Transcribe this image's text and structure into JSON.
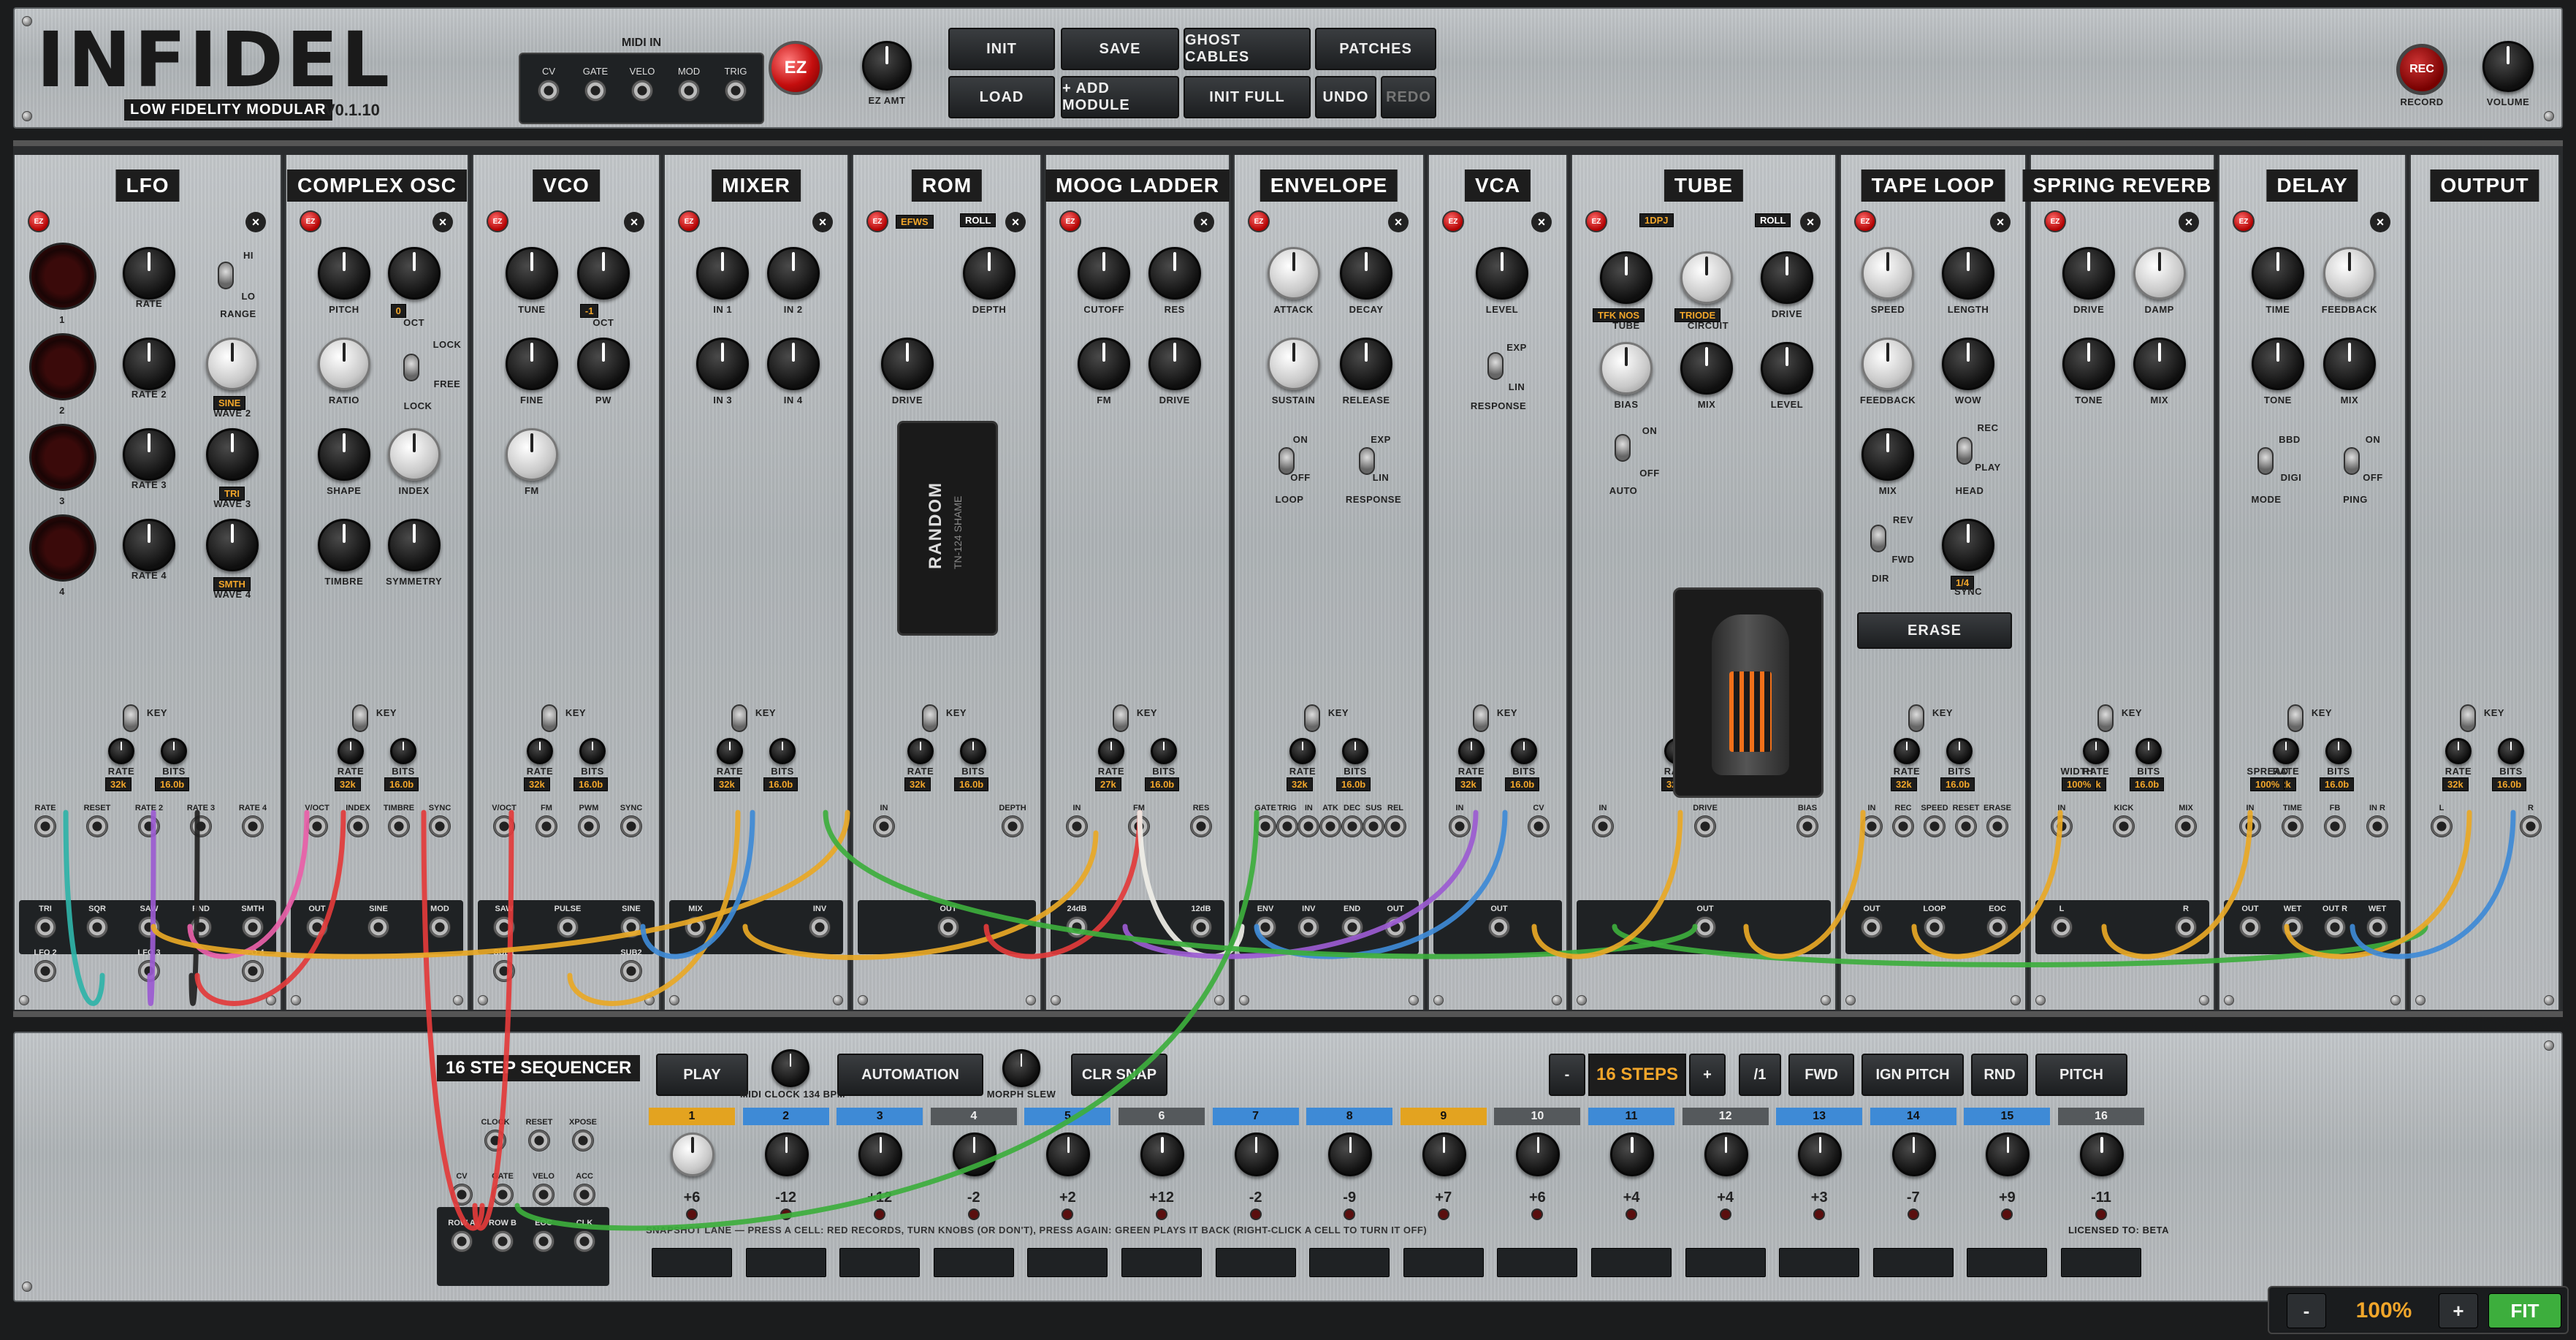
{
  "header": {
    "title": "INFIDEL",
    "subtitle": "LOW FIDELITY MODULAR",
    "version": "V0.1.10",
    "midi_in": {
      "title": "MIDI IN",
      "jacks": [
        "CV",
        "GATE",
        "VELO",
        "MOD",
        "TRIG"
      ]
    },
    "ez_label": "EZ",
    "ez_amt_label": "EZ AMT",
    "buttons_top": [
      "INIT",
      "SAVE",
      "GHOST CABLES",
      "PATCHES"
    ],
    "buttons_bottom": [
      "LOAD",
      "+ ADD MODULE",
      "INIT FULL",
      "UNDO",
      "REDO"
    ],
    "rec_label": "REC",
    "record_label": "RECORD",
    "volume_label": "VOLUME"
  },
  "modules": [
    {
      "title": "LFO"
    },
    {
      "title": "COMPLEX OSC"
    },
    {
      "title": "VCO"
    },
    {
      "title": "MIXER"
    },
    {
      "title": "ROM",
      "tags": [
        "EFWS",
        "ROLL"
      ]
    },
    {
      "title": "MOOG LADDER"
    },
    {
      "title": "ENVELOPE"
    },
    {
      "title": "VCA"
    },
    {
      "title": "TUBE",
      "tags": [
        "1DPJ",
        "ROLL"
      ]
    },
    {
      "title": "TAPE LOOP"
    },
    {
      "title": "SPRING REVERB"
    },
    {
      "title": "DELAY"
    },
    {
      "title": "OUTPUT"
    }
  ],
  "lfo": {
    "labels": [
      "RATE",
      "RANGE",
      "RATE 2",
      "WAVE 2",
      "RATE 3",
      "WAVE 3",
      "RATE 4",
      "WAVE 4"
    ],
    "wave_values": [
      "SINE",
      "TRI",
      "SMTH"
    ],
    "led_labels": [
      "1",
      "2",
      "3",
      "4"
    ],
    "range_hi": "HI",
    "range_lo": "LO"
  },
  "complex_osc": {
    "labels": [
      "PITCH",
      "OCT",
      "RATIO",
      "LOCK",
      "SHAPE",
      "INDEX",
      "TIMBRE",
      "SYMMETRY"
    ],
    "oct_value": "0",
    "lock": "LOCK",
    "free": "FREE"
  },
  "vco": {
    "labels": [
      "TUNE",
      "OCT",
      "FINE",
      "PW",
      "FM"
    ],
    "oct_value": "-1"
  },
  "mixer": {
    "labels": [
      "IN 1",
      "IN 2",
      "IN 3",
      "IN 4"
    ]
  },
  "rom": {
    "labels": [
      "DEPTH",
      "DRIVE"
    ],
    "chip_main": "RANDOM",
    "chip_sub": "TN-124 SHAME"
  },
  "moog": {
    "labels": [
      "CUTOFF",
      "RES",
      "FM",
      "DRIVE"
    ]
  },
  "envelope": {
    "labels": [
      "ATTACK",
      "DECAY",
      "SUSTAIN",
      "RELEASE",
      "LOOP",
      "RESPONSE"
    ],
    "on": "ON",
    "off": "OFF",
    "exp": "EXP",
    "lin": "LIN"
  },
  "vca": {
    "labels": [
      "LEVEL",
      "RESPONSE"
    ],
    "exp": "EXP",
    "lin": "LIN"
  },
  "tube": {
    "labels": [
      "TUBE",
      "CIRCUIT",
      "DRIVE",
      "BIAS",
      "MIX",
      "LEVEL",
      "AUTO"
    ],
    "tube_value": "TFK NOS",
    "circuit_value": "TRIODE",
    "on": "ON",
    "off": "OFF"
  },
  "tape": {
    "labels": [
      "SPEED",
      "LENGTH",
      "FEEDBACK",
      "WOW",
      "MIX",
      "HEAD",
      "DIR",
      "SYNC"
    ],
    "sync_value": "1/4",
    "rec": "REC",
    "play": "PLAY",
    "rev": "REV",
    "fwd": "FWD",
    "erase": "ERASE"
  },
  "reverb": {
    "labels": [
      "DRIVE",
      "DAMP",
      "TONE",
      "MIX"
    ]
  },
  "delay": {
    "labels": [
      "TIME",
      "FEEDBACK",
      "TONE",
      "MIX",
      "MODE",
      "PING"
    ],
    "bbd": "BBD",
    "digi": "DIGI",
    "on": "ON",
    "off": "OFF"
  },
  "bitcrush": {
    "key": "KEY",
    "rate": "RATE",
    "bits": "BITS",
    "rate_values": [
      "32k",
      "32k",
      "32k",
      "32k",
      "32k",
      "27k",
      "32k",
      "32k",
      "32k",
      "32k",
      "32k",
      "32k",
      "32k"
    ],
    "bits_value": "16.0b",
    "width": "WIDTH",
    "width_value": "100%",
    "spread": "SPREAD",
    "spread_value": "100%"
  },
  "jacks": {
    "lfo": [
      "RATE",
      "RESET",
      "RATE 2",
      "RATE 3",
      "RATE 4"
    ],
    "complex_osc": [
      "V/OCT",
      "INDEX",
      "TIMBRE",
      "SYNC"
    ],
    "vco": [
      "V/OCT",
      "FM",
      "PWM",
      "SYNC"
    ],
    "rom": [
      "IN",
      "DEPTH"
    ],
    "moog": [
      "IN",
      "FM",
      "RES"
    ],
    "envelope": [
      "GATE",
      "TRIG",
      "IN",
      "ATK",
      "DEC",
      "SUS",
      "REL"
    ],
    "vca": [
      "IN",
      "CV"
    ],
    "tube": [
      "IN",
      "DRIVE",
      "BIAS"
    ],
    "tape": [
      "IN",
      "REC",
      "SPEED",
      "RESET",
      "ERASE"
    ],
    "reverb": [
      "IN",
      "KICK",
      "MIX"
    ],
    "delay": [
      "IN",
      "TIME",
      "FB",
      "IN R"
    ],
    "output": [
      "L",
      "R"
    ]
  },
  "outputs": {
    "lfo": [
      "TRI",
      "SQR",
      "SAW",
      "RND",
      "SMTH",
      "LFO 2",
      "LFO 3",
      "LFO 4"
    ],
    "complex_osc": [
      "OUT",
      "SINE",
      "MOD"
    ],
    "vco": [
      "SAW",
      "PULSE",
      "SINE",
      "SUB1",
      "SUB2"
    ],
    "mixer": [
      "MIX",
      "INV"
    ],
    "rom": [
      "OUT"
    ],
    "moog": [
      "24dB",
      "12dB"
    ],
    "envelope": [
      "ENV",
      "INV",
      "END",
      "OUT"
    ],
    "vca": [
      "OUT"
    ],
    "tube": [
      "OUT"
    ],
    "tape": [
      "OUT",
      "LOOP",
      "EOC"
    ],
    "reverb": [
      "L",
      "R"
    ],
    "delay": [
      "OUT",
      "WET",
      "OUT R",
      "WET"
    ]
  },
  "sequencer": {
    "title": "16 STEP SEQUENCER",
    "play": "PLAY",
    "midi_clock": "MIDI CLOCK 134 BPM",
    "automation": "AUTOMATION",
    "morph_slew": "MORPH SLEW",
    "clr_snap": "CLR SNAP",
    "minus": "-",
    "steps": "16 STEPS",
    "plus": "+",
    "div": "/1",
    "dir": "FWD",
    "ign_pitch": "IGN PITCH",
    "rnd": "RND",
    "pitch": "PITCH",
    "jacks_top": [
      "CLOCK",
      "RESET",
      "XPOSE"
    ],
    "jacks_mid": [
      "CV",
      "GATE",
      "VELO",
      "ACC"
    ],
    "jacks_bottom": [
      "ROW A",
      "ROW B",
      "EOC",
      "CLK"
    ],
    "steps_list": [
      {
        "n": "1",
        "val": "+6",
        "color": "#e3a320"
      },
      {
        "n": "2",
        "val": "-12",
        "color": "#3e8ad6"
      },
      {
        "n": "3",
        "val": "+12",
        "color": "#3e8ad6"
      },
      {
        "n": "4",
        "val": "-2",
        "color": "#55595c"
      },
      {
        "n": "5",
        "val": "+2",
        "color": "#3e8ad6"
      },
      {
        "n": "6",
        "val": "+12",
        "color": "#55595c"
      },
      {
        "n": "7",
        "val": "-2",
        "color": "#3e8ad6"
      },
      {
        "n": "8",
        "val": "-9",
        "color": "#3e8ad6"
      },
      {
        "n": "9",
        "val": "+7",
        "color": "#e3a320"
      },
      {
        "n": "10",
        "val": "+6",
        "color": "#55595c"
      },
      {
        "n": "11",
        "val": "+4",
        "color": "#3e8ad6"
      },
      {
        "n": "12",
        "val": "+4",
        "color": "#55595c"
      },
      {
        "n": "13",
        "val": "+3",
        "color": "#3e8ad6"
      },
      {
        "n": "14",
        "val": "-7",
        "color": "#3e8ad6"
      },
      {
        "n": "15",
        "val": "+9",
        "color": "#3e8ad6"
      },
      {
        "n": "16",
        "val": "-11",
        "color": "#55595c"
      }
    ],
    "snapshot_note": "SNAPSHOT LANE — PRESS A CELL: RED RECORDS, TURN KNOBS (OR DON'T), PRESS AGAIN: GREEN PLAYS IT BACK (RIGHT-CLICK A CELL TO TURN IT OFF)",
    "licensed": "LICENSED TO: BETA"
  },
  "zoom": {
    "minus": "-",
    "value": "100%",
    "plus": "+",
    "fit": "FIT"
  },
  "colors": {
    "accent": "#f2a62a",
    "rec_red": "#c40e0e",
    "fit_green": "#3dae3d"
  }
}
